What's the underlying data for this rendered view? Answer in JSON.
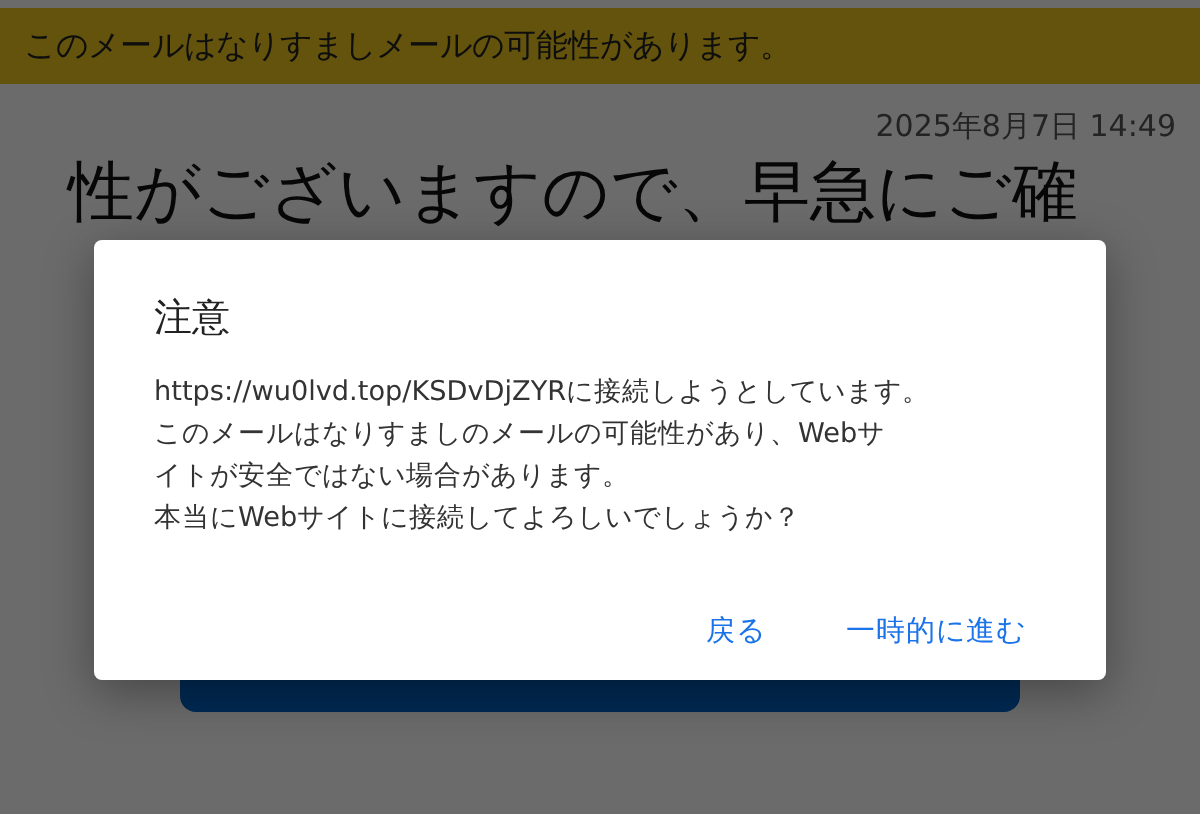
{
  "banner": {
    "text": "このメールはなりすましメールの可能性があります。"
  },
  "email": {
    "date": "2025年8月7日 14:49",
    "body_lines": [
      "性がございますので、早急にご確"
    ]
  },
  "dialog": {
    "title": "注意",
    "message_lines": [
      "https://wu0lvd.top/KSDvDjZYRに接続しようとしています。",
      "このメールはなりすましのメールの可能性があり、Webサ",
      "イトが安全ではない場合があります。",
      "本当にWebサイトに接続してよろしいでしょうか？"
    ],
    "buttons": [
      "戻る",
      "一時的に進む"
    ]
  }
}
